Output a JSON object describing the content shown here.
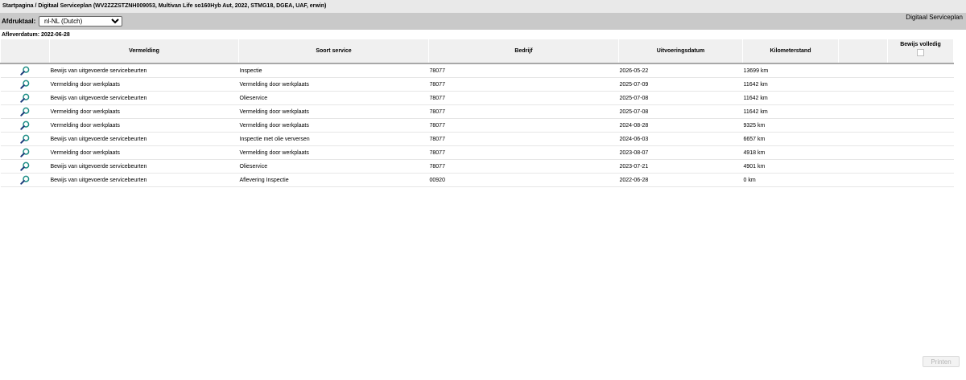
{
  "breadcrumb": "Startpagina / Digitaal Serviceplan (WV2ZZZSTZNH009053, Multivan Life so160Hyb Aut, 2022, STMG18, DGEA, UAF, erwin)",
  "toolbar": {
    "language_label": "Afdruktaal:",
    "language_selected": "nl-NL (Dutch)",
    "app_title": "Digitaal Serviceplan"
  },
  "delivery_date": "Afleverdatum: 2022-06-28",
  "table": {
    "headers": {
      "vermelding": "Vermelding",
      "soort": "Soort service",
      "bedrijf": "Bedrijf",
      "datum": "Uitvoeringsdatum",
      "km": "Kilometerstand",
      "bewijs": "Bewijs volledig"
    },
    "rows": [
      {
        "vermelding": "Bewijs van uitgevoerde servicebeurten",
        "soort": "Inspectie",
        "bedrijf": "78077",
        "datum": "2026-05-22",
        "km": "13699 km"
      },
      {
        "vermelding": "Vermelding door werkplaats",
        "soort": "Vermelding door werkplaats",
        "bedrijf": "78077",
        "datum": "2025-07-09",
        "km": "11642 km"
      },
      {
        "vermelding": "Bewijs van uitgevoerde servicebeurten",
        "soort": "Olieservice",
        "bedrijf": "78077",
        "datum": "2025-07-08",
        "km": "11642 km"
      },
      {
        "vermelding": "Vermelding door werkplaats",
        "soort": "Vermelding door werkplaats",
        "bedrijf": "78077",
        "datum": "2025-07-08",
        "km": "11642 km"
      },
      {
        "vermelding": "Vermelding door werkplaats",
        "soort": "Vermelding door werkplaats",
        "bedrijf": "78077",
        "datum": "2024-08-28",
        "km": "9325 km"
      },
      {
        "vermelding": "Bewijs van uitgevoerde servicebeurten",
        "soort": "Inspectie met olie verversen",
        "bedrijf": "78077",
        "datum": "2024-06-03",
        "km": "6657 km"
      },
      {
        "vermelding": "Vermelding door werkplaats",
        "soort": "Vermelding door werkplaats",
        "bedrijf": "78077",
        "datum": "2023-08-07",
        "km": "4918 km"
      },
      {
        "vermelding": "Bewijs van uitgevoerde servicebeurten",
        "soort": "Olieservice",
        "bedrijf": "78077",
        "datum": "2023-07-21",
        "km": "4901 km"
      },
      {
        "vermelding": "Bewijs van uitgevoerde servicebeurten",
        "soort": "Aflevering Inspectie",
        "bedrijf": "00920",
        "datum": "2022-06-28",
        "km": "0 km"
      }
    ]
  },
  "print_button": "Printen",
  "icons": {
    "row_action": "magnifier-icon"
  }
}
